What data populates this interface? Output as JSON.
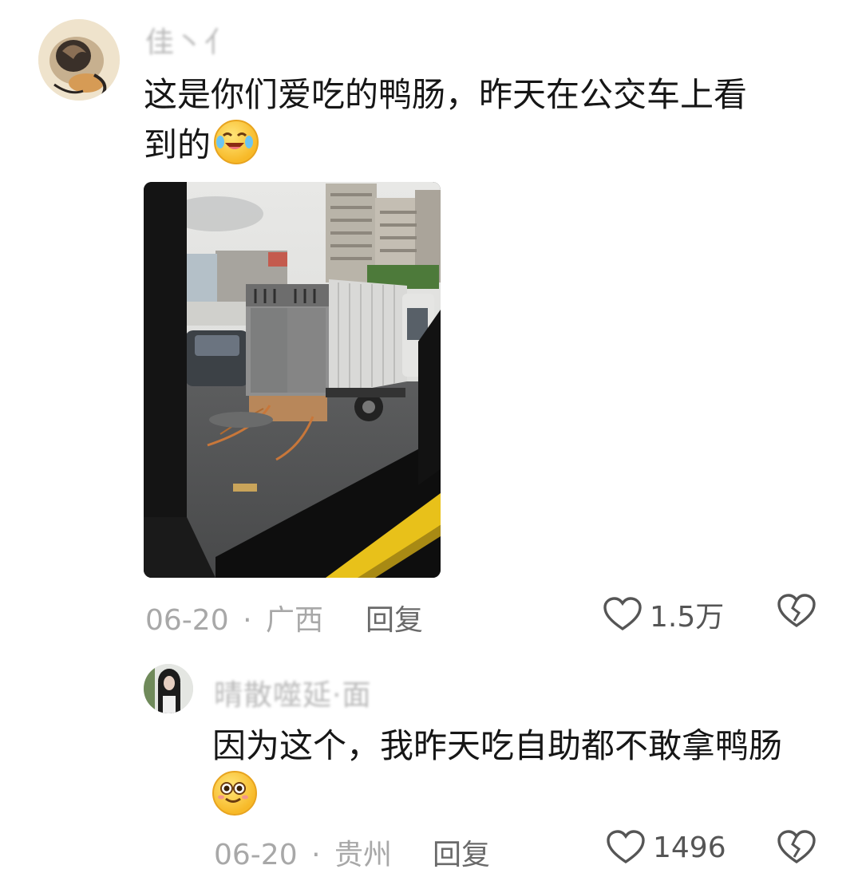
{
  "comment": {
    "username": "佳丶亻",
    "text_line1": "这是你们爱吃的鸭肠，昨天在公交车上看",
    "text_line2": "到的",
    "emoji": "crying-laughing-emoji",
    "date": "06-20",
    "separator": "·",
    "location": "广西",
    "reply_label": "回复",
    "likes": "1.5万"
  },
  "reply": {
    "username": "晴散噬延·面",
    "text_line1": "因为这个，我昨天吃自助都不敢拿鸭肠",
    "emoji": "smiling-emoji",
    "date": "06-20",
    "separator": "·",
    "location": "贵州",
    "reply_label": "回复",
    "likes": "1496"
  },
  "colors": {
    "muted": "#a8a8a8",
    "text": "#161616",
    "bus_rail_yellow": "#e8c11a"
  }
}
